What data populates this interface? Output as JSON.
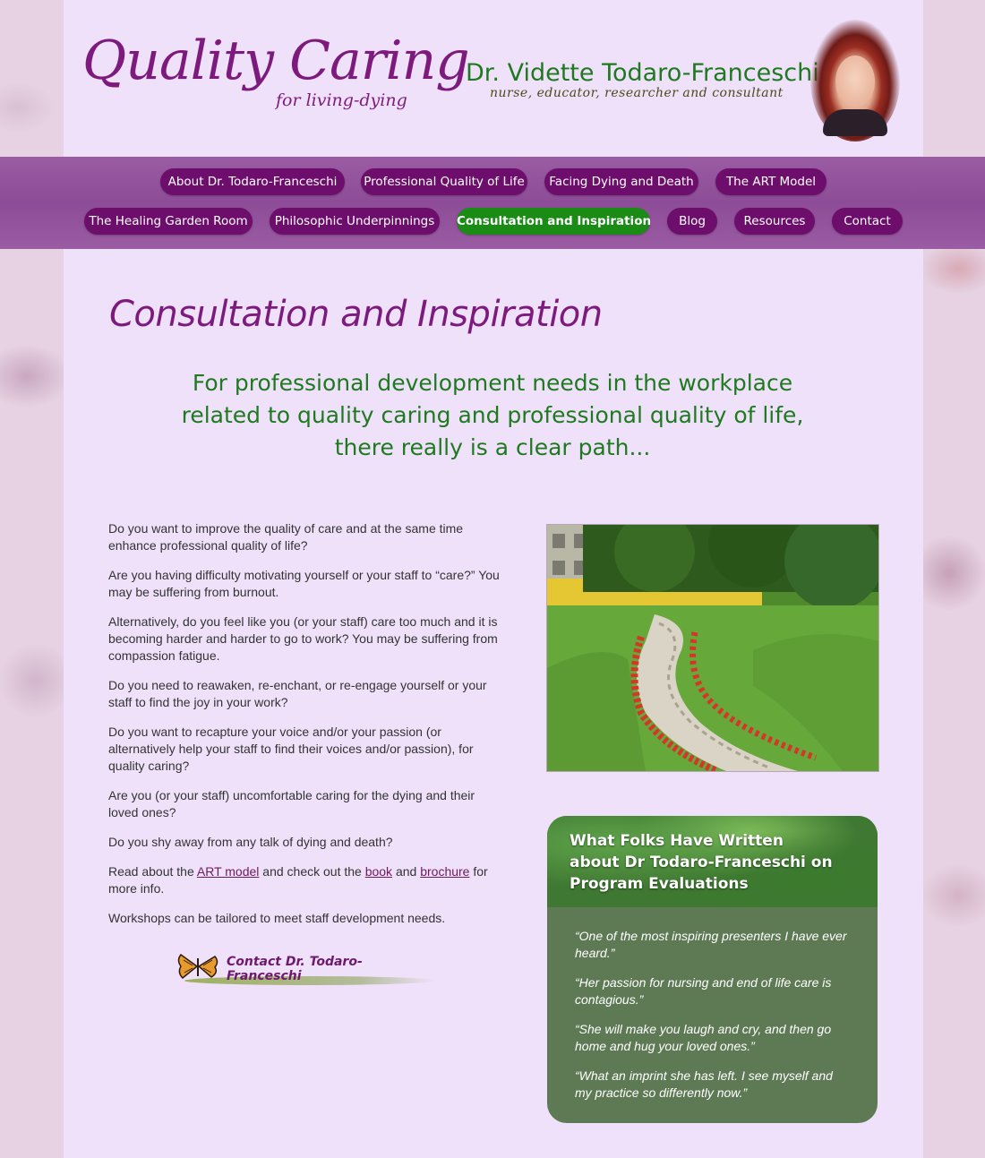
{
  "header": {
    "logo_title": "Quality Caring",
    "logo_subtitle": "for living-dying",
    "doctor_name": "Dr. Vidette Todaro-Franceschi",
    "doctor_role": "nurse, educator, researcher and consultant"
  },
  "nav": {
    "row1": [
      {
        "label": "About Dr. Todaro-Franceschi"
      },
      {
        "label": "Professional Quality of Life"
      },
      {
        "label": "Facing Dying and Death"
      },
      {
        "label": "The ART Model"
      }
    ],
    "row2": [
      {
        "label": "The Healing Garden Room"
      },
      {
        "label": "Philosophic Underpinnings"
      },
      {
        "label": "Consultation and Inspiration",
        "active": true
      },
      {
        "label": "Blog"
      },
      {
        "label": "Resources"
      },
      {
        "label": "Contact"
      }
    ]
  },
  "main": {
    "title": "Consultation and Inspiration",
    "tagline_1": "For professional development needs in the workplace",
    "tagline_2": "related to quality caring and professional quality of life,",
    "tagline_3": "there really is a clear path...",
    "paragraphs": [
      "Do you want to improve the quality of care and at the same time enhance professional quality of life?",
      "Are you having difficulty motivating yourself or your staff to “care?” You may be suffering from burnout.",
      "Alternatively, do you feel like you (or your staff) care too much and it is becoming harder and harder to go to work? You may be suffering from compassion fatigue.",
      "Do you need to reawaken, re-enchant, or re-engage yourself or your staff to find the joy in your work?",
      "Do you want to recapture your voice and/or your passion (or alternatively help your staff to find their voices and/or passion), for quality caring?",
      "Are you (or your staff) uncomfortable caring for the dying and their loved ones?",
      "Do you shy away from any talk of dying and death?"
    ],
    "readabout": {
      "prefix": "Read about the ",
      "link_art": "ART model",
      "mid1": " and check out the ",
      "link_book": "book",
      "mid2": " and ",
      "link_brochure": "brochure",
      "suffix": " for more info."
    },
    "workshops": "Workshops can be tailored to meet staff development needs.",
    "contact_cta": "Contact Dr. Todaro-Franceschi"
  },
  "testimonials": {
    "title": "What Folks Have Written about Dr Todaro-Franceschi on Program Evaluations",
    "quotes": [
      "“One of the most inspiring presenters I have ever heard.”",
      "“Her passion for nursing and end of life care is contagious.”",
      "“She will make you laugh and cry, and then go home and hug your loved ones.”",
      "“What an imprint she has left. I see myself and my practice so differently now.”"
    ]
  },
  "colors": {
    "brand_purple": "#7d1a7e",
    "nav_button": "#6e0e6c",
    "active_green": "#1a8c16",
    "tagline_green": "#1f7a1f",
    "page_bg": "#efe1fa"
  }
}
